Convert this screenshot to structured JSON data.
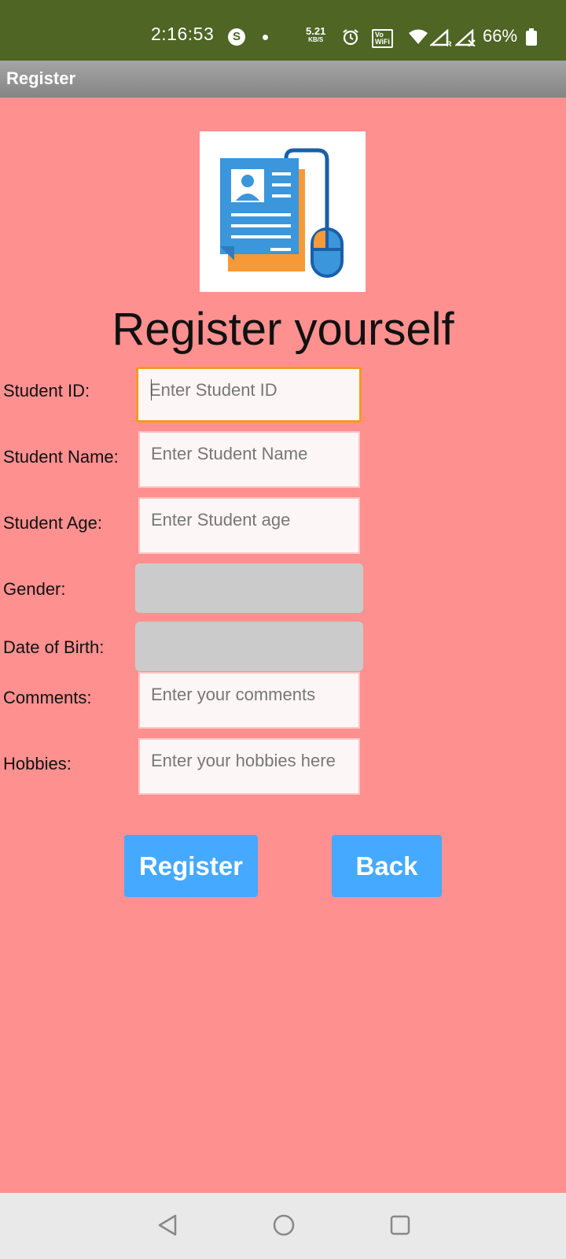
{
  "status_bar": {
    "time": "2:16:53",
    "s_icon": "S",
    "speed_value": "5.21",
    "speed_unit": "KB/S",
    "vowifi_top": "Vo",
    "vowifi_bottom": "WiFi",
    "battery": "66%",
    "icons": [
      "s-app-icon",
      "alarm-icon",
      "vowifi-icon",
      "wifi-icon",
      "signal-icon",
      "battery-icon"
    ]
  },
  "app_bar": {
    "title": "Register"
  },
  "logo": {
    "icon": "document-mouse-icon"
  },
  "heading": "Register yourself",
  "form": {
    "student_id": {
      "label": "Student ID:",
      "placeholder": "Enter Student ID",
      "value": ""
    },
    "student_name": {
      "label": "Student Name:",
      "placeholder": "Enter Student Name",
      "value": ""
    },
    "student_age": {
      "label": "Student Age:",
      "placeholder": "Enter Student age",
      "value": ""
    },
    "gender": {
      "label": "Gender:",
      "value": ""
    },
    "dob": {
      "label": "Date of Birth:",
      "value": ""
    },
    "comments": {
      "label": "Comments:",
      "placeholder": "Enter your comments",
      "value": ""
    },
    "hobbies": {
      "label": "Hobbies:",
      "placeholder": "Enter your hobbies here",
      "value": ""
    }
  },
  "buttons": {
    "register": "Register",
    "back": "Back"
  },
  "colors": {
    "background": "#ff9090",
    "status_bar": "#4e6524",
    "app_bar": "#959595",
    "button": "#45a9ff",
    "focus_border": "#f59a1f",
    "select_bg": "#cbcbcb"
  },
  "nav_bar": {
    "icons": [
      "back-triangle-icon",
      "home-circle-icon",
      "recents-square-icon"
    ]
  }
}
